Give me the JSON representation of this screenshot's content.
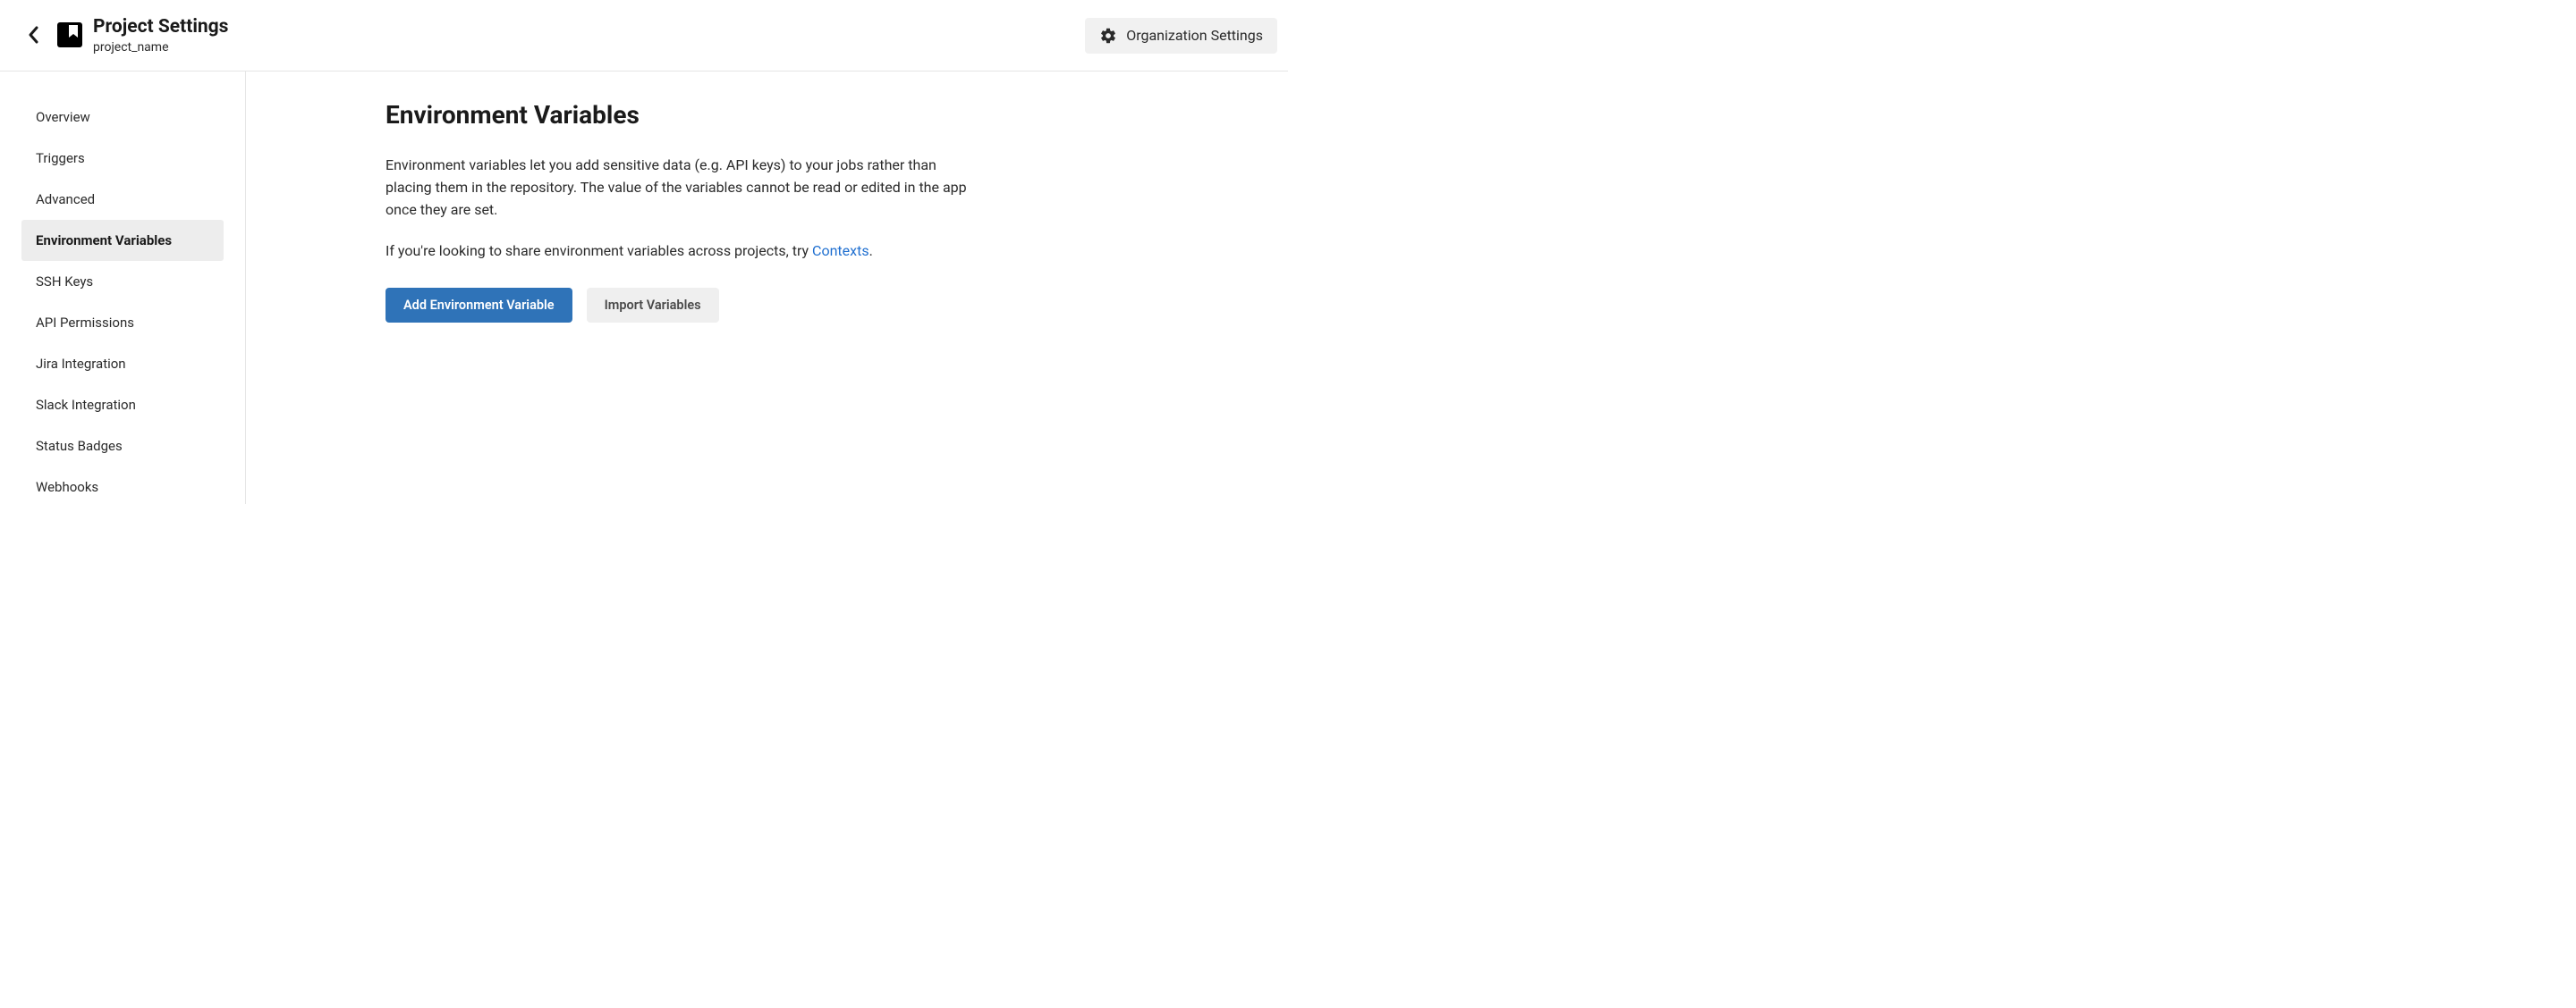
{
  "header": {
    "title": "Project Settings",
    "subtitle": "project_name",
    "org_settings_label": "Organization Settings"
  },
  "sidebar": {
    "items": [
      {
        "label": "Overview",
        "active": false
      },
      {
        "label": "Triggers",
        "active": false
      },
      {
        "label": "Advanced",
        "active": false
      },
      {
        "label": "Environment Variables",
        "active": true
      },
      {
        "label": "SSH Keys",
        "active": false
      },
      {
        "label": "API Permissions",
        "active": false
      },
      {
        "label": "Jira Integration",
        "active": false
      },
      {
        "label": "Slack Integration",
        "active": false
      },
      {
        "label": "Status Badges",
        "active": false
      },
      {
        "label": "Webhooks",
        "active": false
      }
    ]
  },
  "main": {
    "title": "Environment Variables",
    "description": "Environment variables let you add sensitive data (e.g. API keys) to your jobs rather than placing them in the repository. The value of the variables cannot be read or edited in the app once they are set.",
    "description2_prefix": "If you're looking to share environment variables across projects, try ",
    "contexts_link": "Contexts",
    "description2_suffix": ".",
    "add_button": "Add Environment Variable",
    "import_button": "Import Variables"
  }
}
